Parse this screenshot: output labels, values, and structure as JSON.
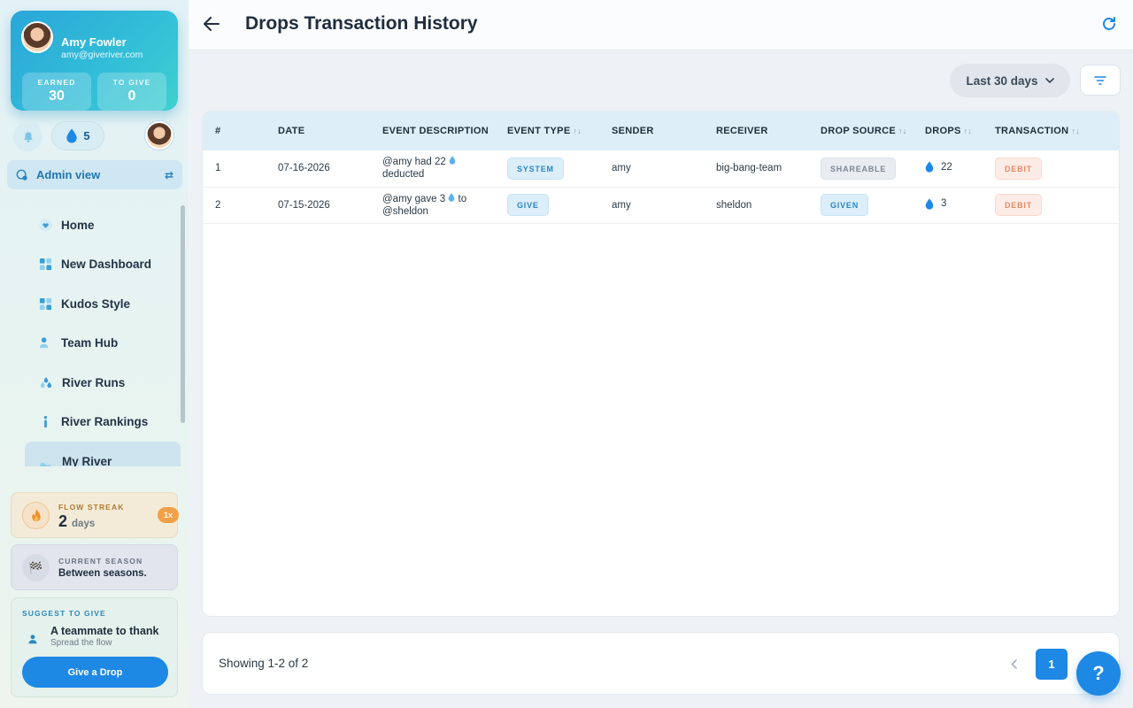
{
  "profile": {
    "name": "Amy Fowler",
    "email": "amy@giveriver.com",
    "earned_label": "EARNED",
    "earned_value": "30",
    "to_give_label": "TO GIVE",
    "to_give_value": "0"
  },
  "drops_count": "5",
  "admin_view_label": "Admin view",
  "nav": [
    {
      "label": "Home",
      "icon": "heart-icon"
    },
    {
      "label": "New Dashboard",
      "icon": "dashboard-icon"
    },
    {
      "label": "Kudos Style",
      "icon": "dashboard-icon"
    },
    {
      "label": "Team Hub",
      "icon": "people-icon"
    },
    {
      "label": "River Runs",
      "icon": "drops-icon"
    },
    {
      "label": "River Rankings",
      "icon": "info-icon"
    },
    {
      "label": "My River",
      "icon": "river-icon"
    }
  ],
  "flow_streak": {
    "label": "FLOW STREAK",
    "value": "2",
    "unit": "days",
    "multiplier": "1x"
  },
  "season": {
    "label": "CURRENT SEASON",
    "value": "Between seasons."
  },
  "suggest": {
    "label": "SUGGEST TO GIVE",
    "title": "A teammate to thank",
    "subtitle": "Spread the flow",
    "button": "Give a Drop"
  },
  "header": {
    "title": "Drops Transaction History"
  },
  "filters": {
    "date_range": "Last 30 days"
  },
  "table": {
    "columns": [
      "#",
      "DATE",
      "EVENT DESCRIPTION",
      "EVENT TYPE",
      "SENDER",
      "RECEIVER",
      "DROP SOURCE",
      "DROPS",
      "TRANSACTION"
    ],
    "rows": [
      {
        "num": "1",
        "date": "07-16-2026",
        "desc_line1": "@amy had 22",
        "desc_line2": "deducted",
        "type": "SYSTEM",
        "sender": "amy",
        "receiver": "big-bang-team",
        "source": "SHAREABLE",
        "drops": "22",
        "transaction": "DEBIT"
      },
      {
        "num": "2",
        "date": "07-15-2026",
        "desc_line1": "@amy gave 3",
        "desc_line1b": "to",
        "desc_line2": "@sheldon",
        "type": "GIVE",
        "sender": "amy",
        "receiver": "sheldon",
        "source": "GIVEN",
        "drops": "3",
        "transaction": "DEBIT"
      }
    ]
  },
  "pagination": {
    "showing": "Showing 1-2 of 2",
    "current_page": "1"
  },
  "help_label": "?",
  "colors": {
    "primary": "#1e88e5",
    "header_bg": "#ddeef8",
    "debit": "#e68a66"
  }
}
